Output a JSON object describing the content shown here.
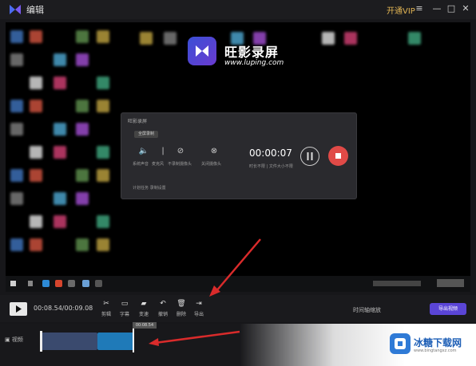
{
  "titlebar": {
    "title": "编辑",
    "vip": "开通VIP",
    "minimize": "—",
    "maximize": "□",
    "close": "✕"
  },
  "preview": {
    "brand_name": "旺影录屏",
    "brand_url": "www.luping.com",
    "recorder": {
      "title": "旺影录屏",
      "mode_chip": "全屏录制",
      "labels": [
        "系统声音",
        "麦克风",
        "不录制摄像头",
        "关闭摄像头"
      ],
      "timer": "00:00:07",
      "sub": "时长不限 | 文件大小不限",
      "bottom": "计划任务      录制设置"
    }
  },
  "toolbar": {
    "time": "00:08.54/00:09.08",
    "tools": [
      {
        "icon": "scissors-icon",
        "glyph": "✂",
        "label": "剪辑"
      },
      {
        "icon": "subtitle-icon",
        "glyph": "▭",
        "label": "字幕"
      },
      {
        "icon": "speed-icon",
        "glyph": "▰",
        "label": "变速"
      },
      {
        "icon": "undo-icon",
        "glyph": "↶",
        "label": "撤销"
      },
      {
        "icon": "trash-icon",
        "glyph": "🗑",
        "label": "删除"
      },
      {
        "icon": "export-icon",
        "glyph": "⇥",
        "label": "导出"
      }
    ],
    "right_text": "时间轴缩放",
    "export_button": "导出视频"
  },
  "timeline": {
    "track_label": "视频",
    "playhead_tag": "00:08.54"
  },
  "watermark": {
    "name": "冰糖下载网",
    "url": "www.bingtangxz.com"
  },
  "colors": {
    "accent": "#5a45d6",
    "record_red": "#e04a47",
    "clip_blue": "#1f7ab8",
    "vip_gold": "#e2b554"
  }
}
